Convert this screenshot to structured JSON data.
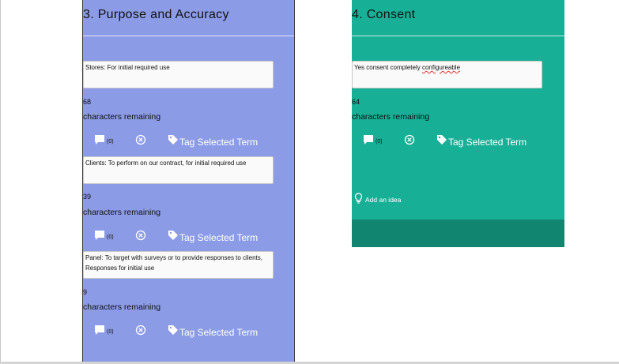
{
  "purpose": {
    "title": "3. Purpose and Accuracy",
    "terms": [
      {
        "text": "Stores: For initial required use",
        "remaining": "68"
      },
      {
        "text": "Clients: To perform on our contract, for initial required use",
        "remaining": "39"
      },
      {
        "text": "Panel: To target with surveys or to provide responses to clients, Responses for initial use",
        "remaining": "9"
      }
    ]
  },
  "consent": {
    "title": "4. Consent",
    "term": {
      "text_before": "Yes consent completely ",
      "text_misspelled": "configureable",
      "remaining": "64"
    }
  },
  "common": {
    "remaining_label": "characters remaining",
    "comment_count": "(0)",
    "tag_label": "Tag Selected Term",
    "add_idea_label": "Add an idea"
  },
  "icons": {
    "comment": "comment-icon",
    "remove": "remove-circle-icon",
    "tag": "tag-icon",
    "idea": "lightbulb-icon"
  },
  "colors": {
    "purpose_bg": "#8b9be6",
    "consent_bg": "#17b096",
    "consent_footer": "#128571"
  }
}
